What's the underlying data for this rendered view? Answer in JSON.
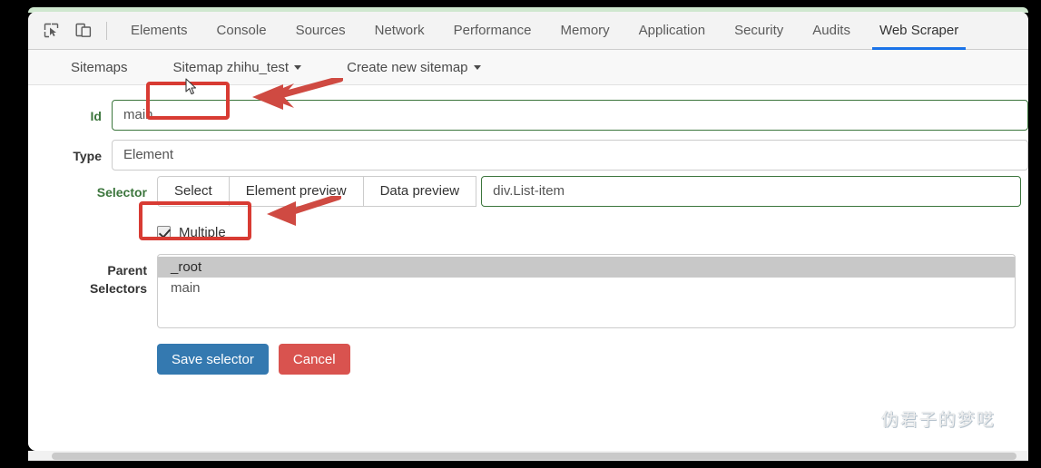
{
  "window": {
    "accent_color": "#1a73e8",
    "valid_color": "#3c763d",
    "annotation_color": "#d83b33"
  },
  "devtools": {
    "icons": [
      {
        "name": "inspect-element-icon",
        "title": "Inspect element"
      },
      {
        "name": "device-toolbar-icon",
        "title": "Toggle device toolbar"
      }
    ],
    "tabs": [
      {
        "label": "Elements",
        "active": false
      },
      {
        "label": "Console",
        "active": false
      },
      {
        "label": "Sources",
        "active": false
      },
      {
        "label": "Network",
        "active": false
      },
      {
        "label": "Performance",
        "active": false
      },
      {
        "label": "Memory",
        "active": false
      },
      {
        "label": "Application",
        "active": false
      },
      {
        "label": "Security",
        "active": false
      },
      {
        "label": "Audits",
        "active": false
      },
      {
        "label": "Web Scraper",
        "active": true
      }
    ]
  },
  "navbar": {
    "items": [
      {
        "label": "Sitemaps",
        "has_caret": false
      },
      {
        "label": "Sitemap zhihu_test",
        "has_caret": true
      },
      {
        "label": "Create new sitemap",
        "has_caret": true
      }
    ]
  },
  "form": {
    "id": {
      "label": "Id",
      "value": "main",
      "state": "valid"
    },
    "type": {
      "label": "Type",
      "value": "Element"
    },
    "selector": {
      "label": "Selector",
      "state": "valid",
      "buttons": [
        "Select",
        "Element preview",
        "Data preview"
      ],
      "value": "div.List-item",
      "multiple": {
        "label": "Multiple",
        "checked": true
      }
    },
    "parent_selectors": {
      "label_line1": "Parent",
      "label_line2": "Selectors",
      "options": [
        {
          "label": "_root",
          "selected": true
        },
        {
          "label": "main",
          "selected": false
        }
      ]
    },
    "actions": {
      "save": "Save selector",
      "cancel": "Cancel"
    }
  },
  "annotations": {
    "boxes": [
      {
        "name": "id-field-highlight"
      },
      {
        "name": "multiple-checkbox-highlight"
      }
    ],
    "arrows": [
      {
        "name": "id-field-arrow"
      },
      {
        "name": "multiple-checkbox-arrow"
      }
    ]
  },
  "watermark": {
    "text": "伪君子的梦呓"
  }
}
